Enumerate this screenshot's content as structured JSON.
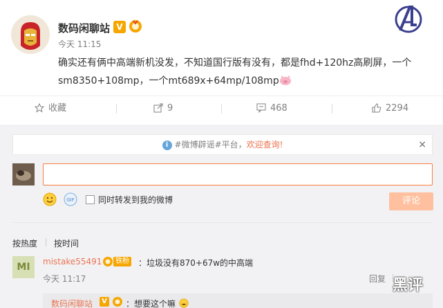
{
  "post": {
    "username": "数码闲聊站",
    "verified_badge": "V",
    "time": "今天 11:15",
    "text": "确实还有俩中高端新机没发，不知道国行版有没有，都是fhd+120hz高刷屏，一个sm8350+108mp，一个mt689x+64mp/108mp",
    "avatar_icon": "iron-man-avatar",
    "brand_icon": "avengers-logo-icon"
  },
  "actions": {
    "favorite": "收藏",
    "repost_count": "9",
    "comment_count": "468",
    "like_count": "2294"
  },
  "notice": {
    "prefix": "#微博辟谣#平台，",
    "link": "欢迎查询!",
    "close": "×"
  },
  "composer": {
    "input_value": "",
    "also_repost_label": "同时转发到我的微博",
    "submit_label": "评论"
  },
  "sort": {
    "by_hot": "按热度",
    "by_time": "按时间"
  },
  "comment": {
    "avatar_text": "MI",
    "username": "mistake55491",
    "fan_badge": "铁粉",
    "text": "：垃圾没有870+67w的中高端",
    "time": "今天 11:17",
    "reply_label": "回复",
    "sub_reply": {
      "username": "数码闲聊站",
      "verified_badge": "V",
      "text": "：想要这个嘛"
    }
  },
  "watermark": "黑评",
  "colors": {
    "accent": "#eb7350",
    "submit_disabled": "#ffc09f",
    "gold": "#f7a600",
    "info_blue": "#66a5dc"
  }
}
